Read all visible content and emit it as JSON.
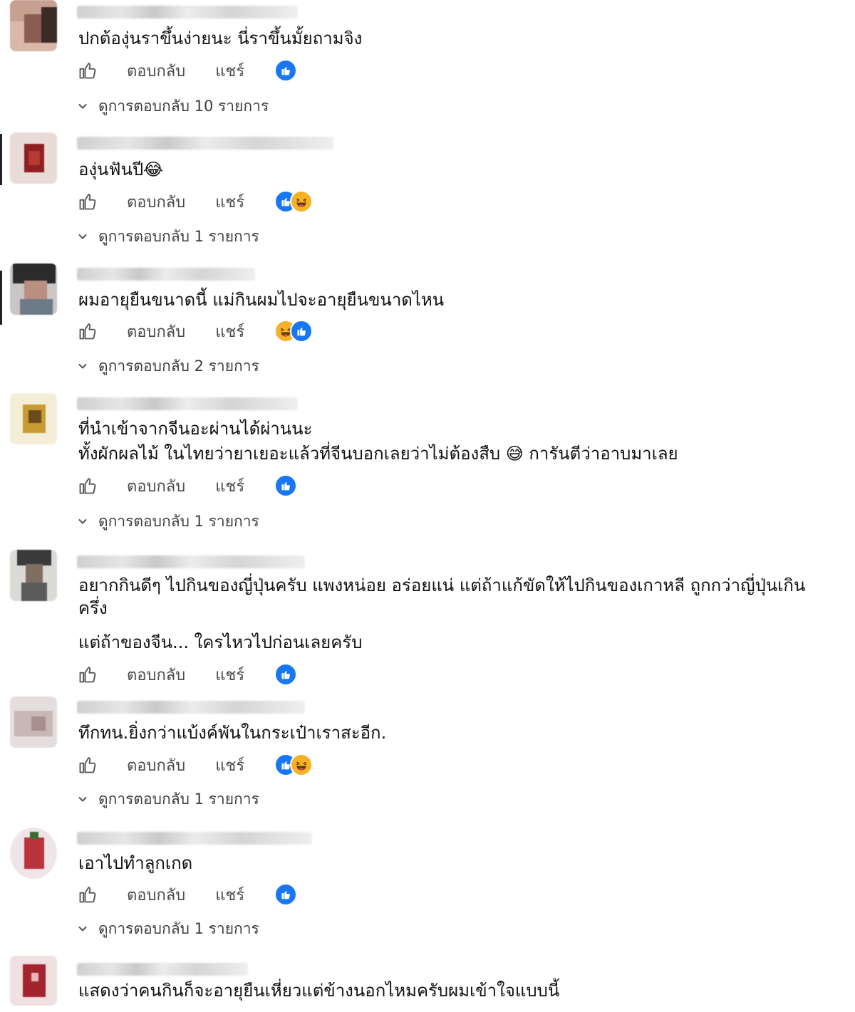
{
  "actions": {
    "reply_label": "ตอบกลับ",
    "share_label": "แชร์"
  },
  "icons": {
    "like": "thumbs-up-outline-icon",
    "reaction_like": "like-reaction-icon",
    "reaction_haha": "haha-reaction-icon",
    "chevron": "chevron-down-icon"
  },
  "colors": {
    "like_blue": "#1877f2",
    "haha_yellow": "#f7b125",
    "text": "#111111",
    "muted": "#4a4a4a"
  },
  "comments": [
    {
      "text": "ปกต้องุ่นราขึ้นง่ายนะ นี่ราขึ้นมั้ยถามจิง",
      "reactions": [
        "like"
      ],
      "replies": "ดูการตอบกลับ 10 รายการ"
    },
    {
      "text": "องุ่นฟันปี😂",
      "reactions": [
        "like",
        "haha"
      ],
      "replies": "ดูการตอบกลับ 1 รายการ"
    },
    {
      "text": "ผมอายุยืนขนาดนี้ แม่กินผมไปจะอายุยืนขนาดไหน",
      "reactions": [
        "haha",
        "like"
      ],
      "replies": "ดูการตอบกลับ 2 รายการ"
    },
    {
      "text_lines": [
        "ที่นำเข้าจากจีนอะผ่านได้ผ่านนะ",
        "ทั้งผักผลไม้ ในไทยว่ายาเยอะแล้วที่จีนบอกเลยว่าไม่ต้องสืบ 😅 การันตีว่าอาบมาเลย"
      ],
      "reactions": [
        "like"
      ],
      "replies": "ดูการตอบกลับ 1 รายการ"
    },
    {
      "text_para1": "อยากกินดีๆ ไปกินของญี่ปุ่นครับ แพงหน่อย อร่อยแน่ แต่ถ้าแก้ขัดให้ไปกินของเกาหลี ถูกกว่าญี่ปุ่นเกินครึ่ง",
      "text_para2": "แต่ถ้าของจีน... ใครไหวไปก่อนเลยครับ",
      "reactions": [
        "like"
      ]
    },
    {
      "text": "ทึกทน.ยิ่งกว่าแบ้งค์พันในกระเป๋าเราสะอีก.",
      "reactions": [
        "like",
        "haha"
      ],
      "replies": "ดูการตอบกลับ 1 รายการ"
    },
    {
      "text": "เอาไปทำลูกเกด",
      "reactions": [
        "like"
      ],
      "replies": "ดูการตอบกลับ 1 รายการ"
    },
    {
      "text": "แสดงว่าคนกินก็จะอายุยืนเหี่ยวแต่ข้างนอกไหมครับผมเข้าใจแบบนี้"
    }
  ]
}
